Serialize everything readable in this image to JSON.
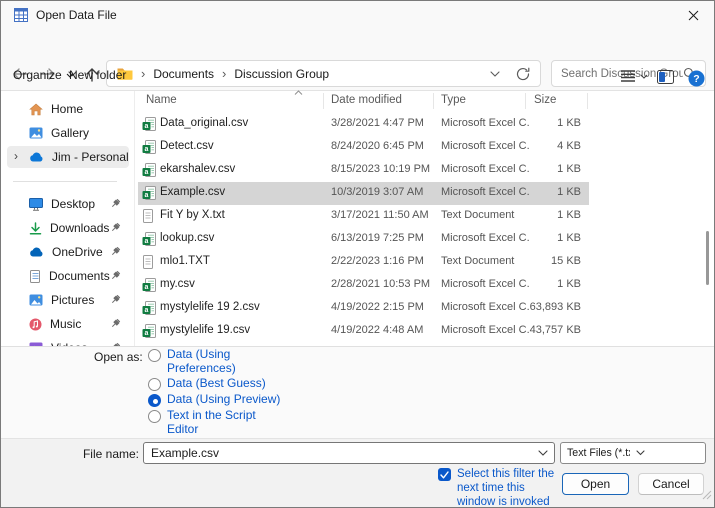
{
  "window": {
    "title": "Open Data File"
  },
  "nav": {
    "breadcrumb": {
      "crumb1": "Documents",
      "crumb2": "Discussion Group",
      "separator": "›"
    },
    "search": {
      "placeholder": "Search Discussion Group"
    }
  },
  "toolbar": {
    "organize_label": "Organize",
    "new_folder_label": "New folder"
  },
  "sidebar": {
    "items": [
      {
        "label": "Home",
        "icon": "home",
        "pinned": false,
        "selected": false
      },
      {
        "label": "Gallery",
        "icon": "gallery",
        "pinned": false,
        "selected": false
      },
      {
        "label": "Jim - Personal",
        "icon": "onedrive-cloud",
        "pinned": false,
        "selected": true,
        "expandable": true
      },
      {
        "label": "Desktop",
        "icon": "desktop",
        "pinned": true,
        "selected": false
      },
      {
        "label": "Downloads",
        "icon": "downloads",
        "pinned": true,
        "selected": false
      },
      {
        "label": "OneDrive",
        "icon": "onedrive-cloud",
        "pinned": true,
        "selected": false
      },
      {
        "label": "Documents",
        "icon": "documents",
        "pinned": true,
        "selected": false
      },
      {
        "label": "Pictures",
        "icon": "pictures",
        "pinned": true,
        "selected": false
      },
      {
        "label": "Music",
        "icon": "music",
        "pinned": true,
        "selected": false
      },
      {
        "label": "Videos",
        "icon": "videos",
        "pinned": true,
        "selected": false
      }
    ]
  },
  "file_list": {
    "columns": {
      "name": "Name",
      "date": "Date modified",
      "type": "Type",
      "size": "Size"
    },
    "rows": [
      {
        "name": "Data_original.csv",
        "date": "3/28/2021 4:47 PM",
        "type": "Microsoft Excel C...",
        "size": "1 KB",
        "icon": "excel-csv",
        "selected": false
      },
      {
        "name": "Detect.csv",
        "date": "8/24/2020 6:45 PM",
        "type": "Microsoft Excel C...",
        "size": "4 KB",
        "icon": "excel-csv",
        "selected": false
      },
      {
        "name": "ekarshalev.csv",
        "date": "8/15/2023 10:19 PM",
        "type": "Microsoft Excel C...",
        "size": "1 KB",
        "icon": "excel-csv",
        "selected": false
      },
      {
        "name": "Example.csv",
        "date": "10/3/2019 3:07 AM",
        "type": "Microsoft Excel C...",
        "size": "1 KB",
        "icon": "excel-csv",
        "selected": true
      },
      {
        "name": "Fit Y by X.txt",
        "date": "3/17/2021 11:50 AM",
        "type": "Text Document",
        "size": "1 KB",
        "icon": "text-doc",
        "selected": false
      },
      {
        "name": "lookup.csv",
        "date": "6/13/2019 7:25 PM",
        "type": "Microsoft Excel C...",
        "size": "1 KB",
        "icon": "excel-csv",
        "selected": false
      },
      {
        "name": "mlo1.TXT",
        "date": "2/22/2023 1:16 PM",
        "type": "Text Document",
        "size": "15 KB",
        "icon": "text-doc",
        "selected": false
      },
      {
        "name": "my.csv",
        "date": "2/28/2021 10:53 PM",
        "type": "Microsoft Excel C...",
        "size": "1 KB",
        "icon": "excel-csv",
        "selected": false
      },
      {
        "name": "mystylelife 19 2.csv",
        "date": "4/19/2022 2:15 PM",
        "type": "Microsoft Excel C...",
        "size": "63,893 KB",
        "icon": "excel-csv",
        "selected": false
      },
      {
        "name": "mystylelife 19.csv",
        "date": "4/19/2022 4:48 AM",
        "type": "Microsoft Excel C...",
        "size": "43,757 KB",
        "icon": "excel-csv",
        "selected": false
      }
    ]
  },
  "open_as": {
    "label": "Open as:",
    "options": [
      {
        "label": "Data (Using Preferences)",
        "selected": false
      },
      {
        "label": "Data (Best Guess)",
        "selected": false
      },
      {
        "label": "Data (Using Preview)",
        "selected": true
      },
      {
        "label": "Text in the Script Editor",
        "selected": false
      }
    ]
  },
  "footer": {
    "file_name_label": "File name:",
    "file_name_value": "Example.csv",
    "filter_value": "Text Files (*.txt;*.csv;*.dat;*.tsv)",
    "checkbox_label": "Select this filter the next time this window is invoked",
    "checkbox_checked": true,
    "open_button": "Open",
    "cancel_button": "Cancel"
  },
  "colors": {
    "accent_blue": "#0a58ca",
    "help_blue": "#1971d2",
    "excel_green": "#107C41",
    "folder_yellow": "#FFC83D",
    "selected_row_gray": "#d5d5d5"
  }
}
